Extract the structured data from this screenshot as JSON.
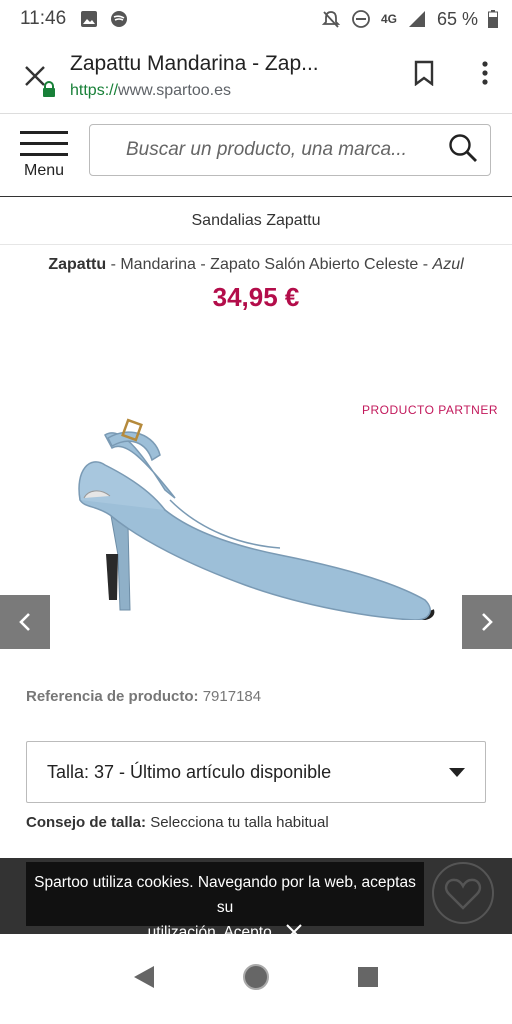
{
  "status_bar": {
    "time": "11:46",
    "network": "4G",
    "battery": "65 %"
  },
  "browser": {
    "page_title": "Zapattu Mandarina - Zap...",
    "url_scheme": "https://",
    "url_host": "www.spartoo.es"
  },
  "site_header": {
    "menu_label": "Menu",
    "search_placeholder": "Buscar un producto, una marca..."
  },
  "breadcrumb": "Sandalias Zapattu",
  "product": {
    "brand": "Zapattu",
    "title_middle": " - Mandarina - Zapato Salón Abierto Celeste - ",
    "color": "Azul",
    "price": "34,95 €",
    "partner_label": "PRODUCTO PARTNER",
    "reference_label": "Referencia de producto:",
    "reference_value": " 7917184"
  },
  "size": {
    "selected": "Talla: 37 - Último artículo disponible",
    "tip_label": "Consejo de talla:",
    "tip_value": " Selecciona tu talla habitual"
  },
  "cookie_banner": {
    "text_line1": "Spartoo utiliza cookies. Navegando por la web, aceptas su",
    "text_line2": "utilización. ",
    "accept_label": "Acepto."
  },
  "colors": {
    "price": "#b30d4a",
    "partner": "#c2185b",
    "secure_lock": "#188038",
    "shoe": "#9dbfd8"
  }
}
